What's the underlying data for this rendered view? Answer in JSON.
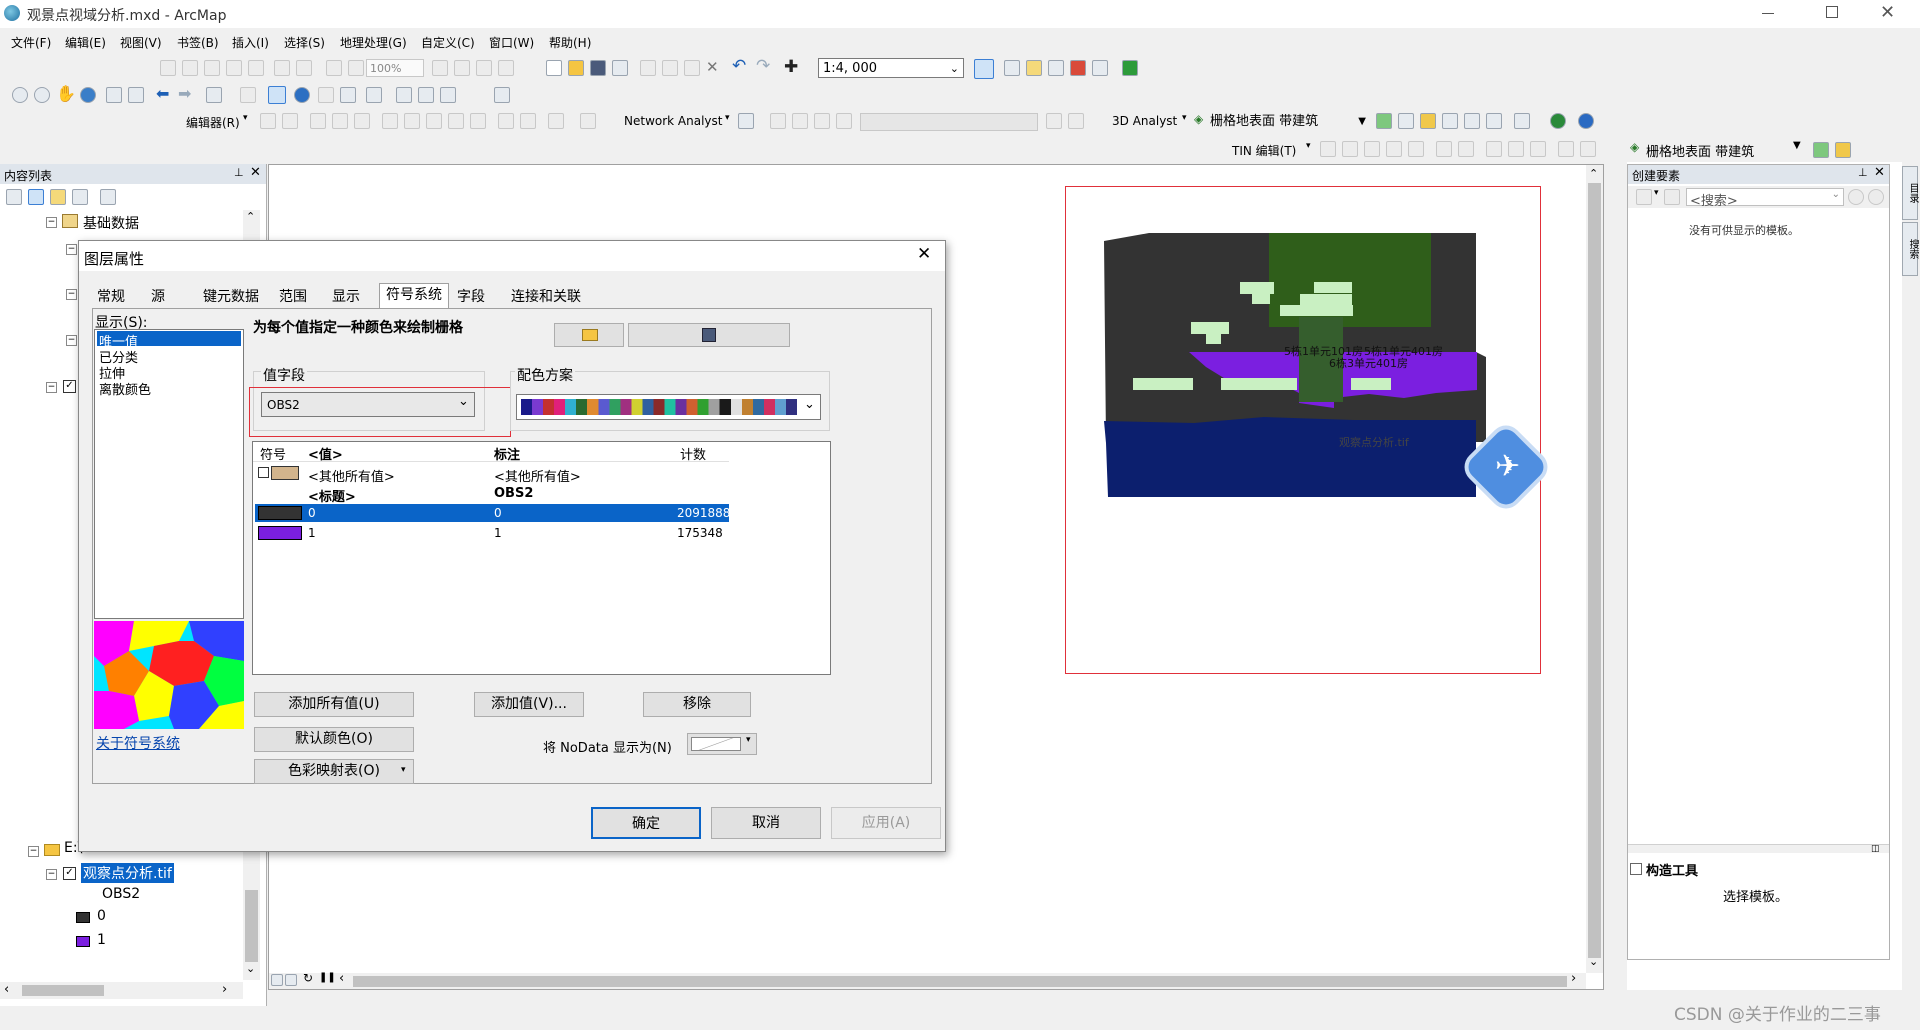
{
  "window": {
    "title": "观景点视域分析.mxd - ArcMap"
  },
  "menu": [
    "文件(F)",
    "编辑(E)",
    "视图(V)",
    "书签(B)",
    "插入(I)",
    "选择(S)",
    "地理处理(G)",
    "自定义(C)",
    "窗口(W)",
    "帮助(H)"
  ],
  "toolbar": {
    "zoom_value": "100%",
    "scale_value": "1:4, 000",
    "editor_label": "编辑器(R)",
    "network_analyst_label": "Network Analyst",
    "analyst_3d_label": "3D Analyst",
    "layer_select": "栅格地表面 带建筑",
    "tin_edit_label": "TIN 编辑(T)"
  },
  "toc": {
    "title": "内容列表",
    "group_basic": "基础数据",
    "group_e": "E:\\",
    "layer_name": "观察点分析.tif",
    "field_name": "OBS2",
    "legend": [
      {
        "label": "0",
        "color": "#333333"
      },
      {
        "label": "1",
        "color": "#7b1fe0"
      }
    ]
  },
  "dialog": {
    "title": "图层属性",
    "tabs": [
      "常规",
      "源",
      "键元数据",
      "范围",
      "显示",
      "符号系统",
      "字段",
      "连接和关联"
    ],
    "active_tab": "符号系统",
    "show_label": "显示(S):",
    "show_items": [
      "唯一值",
      "已分类",
      "拉伸",
      "离散颜色"
    ],
    "description": "为每个值指定一种颜色来绘制栅格",
    "value_field_label": "值字段",
    "value_field": "OBS2",
    "color_scheme_label": "配色方案",
    "table_headers": {
      "symbol": "符号",
      "value": "<值>",
      "label": "标注",
      "count": "计数"
    },
    "other_values": {
      "value": "<其他所有值>",
      "label": "<其他所有值>"
    },
    "heading_row": {
      "value": "<标题>",
      "label": "OBS2"
    },
    "rows": [
      {
        "value": "0",
        "label": "0",
        "count": "2091888",
        "color": "#333333",
        "selected": true
      },
      {
        "value": "1",
        "label": "1",
        "count": "175348",
        "color": "#7b1fe0",
        "selected": false
      }
    ],
    "add_all_button": "添加所有值(U)",
    "add_value_button": "添加值(V)...",
    "remove_button": "移除",
    "default_color_button": "默认颜色(O)",
    "colormap_button": "色彩映射表(O)",
    "nodata_label": "将 NoData 显示为(N)",
    "about_link": "关于符号系统",
    "ok_button": "确定",
    "cancel_button": "取消",
    "apply_button": "应用(A)"
  },
  "map": {
    "labels": [
      "5栋1单元101房",
      "5栋1单元401房",
      "6栋3单元401房"
    ],
    "dim_label": "观察点分析.tif"
  },
  "right_panel": {
    "toolbar_select": "栅格地表面 带建筑",
    "create_features_title": "创建要素",
    "search_placeholder": "<搜索>",
    "no_templates": "没有可供显示的模板。",
    "construct_tools_title": "构造工具",
    "select_template": "选择模板。",
    "side_tabs": [
      "目录",
      "搜索"
    ]
  },
  "watermark": "CSDN @关于作业的二三事"
}
